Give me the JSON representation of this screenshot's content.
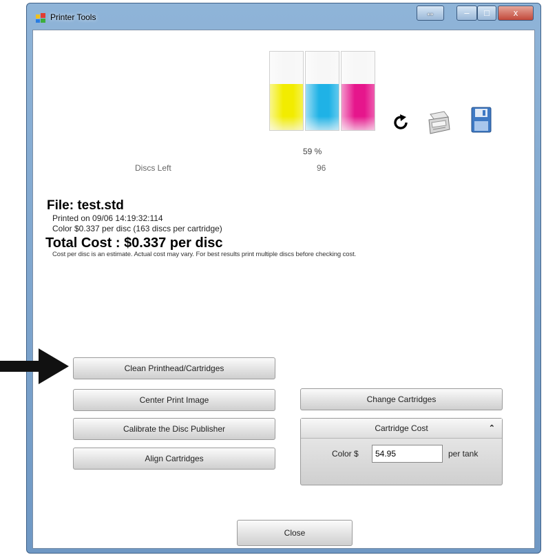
{
  "window": {
    "title": "Printer Tools",
    "controls": {
      "resize": "↔",
      "minimize": "–",
      "maximize": "□",
      "close": "x"
    }
  },
  "ink": {
    "tanks": [
      {
        "name": "yellow",
        "color": "#f2ec00",
        "level": 0.59
      },
      {
        "name": "cyan",
        "color": "#1fb2e6",
        "level": 0.59
      },
      {
        "name": "magenta",
        "color": "#e6168c",
        "level": 0.59
      }
    ],
    "percent": "59 %",
    "discs_left_label": "Discs Left",
    "discs_left_value": "96"
  },
  "file": {
    "title": "File: test.std",
    "printed_on": "Printed on 09/06 14:19:32:114",
    "color_cost": "Color $0.337 per disc (163 discs per cartridge)",
    "total_cost": "Total Cost : $0.337 per disc",
    "note": "Cost per disc is an estimate. Actual cost may vary. For best results print multiple discs before checking cost."
  },
  "buttons": {
    "clean": "Clean Printhead/Cartridges",
    "center": "Center Print Image",
    "calibrate": "Calibrate the Disc Publisher",
    "align": "Align Cartridges",
    "change": "Change Cartridges",
    "close": "Close"
  },
  "cartridge_cost": {
    "header": "Cartridge Cost",
    "color_label": "Color $",
    "color_value": "54.95",
    "unit": "per tank"
  },
  "icons": [
    "refresh-icon",
    "printer-icon",
    "save-icon",
    "arrow-icon"
  ]
}
